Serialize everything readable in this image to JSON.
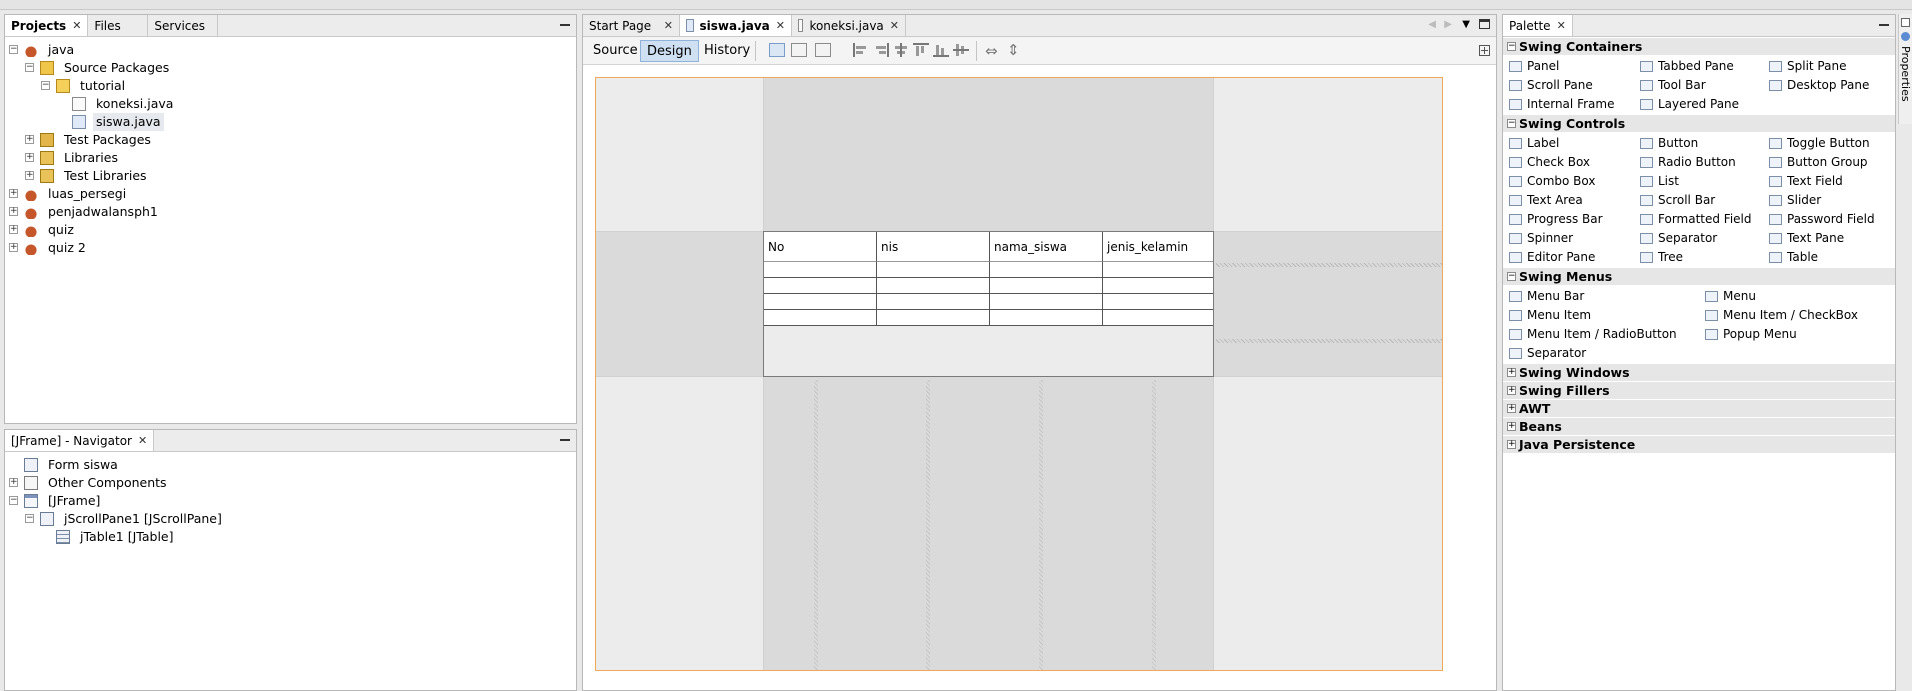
{
  "projects_panel": {
    "tabs": [
      "Projects",
      "Files",
      "Services"
    ],
    "tree": [
      {
        "label": "java",
        "level": 0,
        "expander": "−",
        "icon": "java-project-icon"
      },
      {
        "label": "Source Packages",
        "level": 1,
        "expander": "−",
        "icon": "source-packages-icon"
      },
      {
        "label": "tutorial",
        "level": 2,
        "expander": "−",
        "icon": "package-icon"
      },
      {
        "label": "koneksi.java",
        "level": 3,
        "expander": "",
        "icon": "java-file-icon"
      },
      {
        "label": "siswa.java",
        "level": 3,
        "expander": "",
        "icon": "form-file-icon"
      },
      {
        "label": "Test Packages",
        "level": 1,
        "expander": "+",
        "icon": "test-packages-icon"
      },
      {
        "label": "Libraries",
        "level": 1,
        "expander": "+",
        "icon": "libraries-icon"
      },
      {
        "label": "Test Libraries",
        "level": 1,
        "expander": "+",
        "icon": "test-libraries-icon"
      },
      {
        "label": "luas_persegi",
        "level": 0,
        "expander": "+",
        "icon": "java-project-icon"
      },
      {
        "label": "penjadwalansph1",
        "level": 0,
        "expander": "+",
        "icon": "java-project-icon"
      },
      {
        "label": "quiz",
        "level": 0,
        "expander": "+",
        "icon": "java-project-icon"
      },
      {
        "label": "quiz 2",
        "level": 0,
        "expander": "+",
        "icon": "java-project-icon"
      }
    ]
  },
  "navigator_panel": {
    "title": "[JFrame] - Navigator",
    "tree": [
      {
        "label": "Form siswa",
        "level": 0,
        "expander": "",
        "icon": "form-icon"
      },
      {
        "label": "Other Components",
        "level": 0,
        "expander": "+",
        "icon": "other-components-icon"
      },
      {
        "label": "[JFrame]",
        "level": 0,
        "expander": "−",
        "icon": "jframe-icon"
      },
      {
        "label": "jScrollPane1 [JScrollPane]",
        "level": 1,
        "expander": "−",
        "icon": "scrollpane-icon"
      },
      {
        "label": "jTable1 [JTable]",
        "level": 2,
        "expander": "",
        "icon": "table-icon"
      }
    ]
  },
  "editor": {
    "tabs": [
      "Start Page",
      "siswa.java",
      "koneksi.java"
    ],
    "active_tab": "siswa.java",
    "view_buttons": [
      "Source",
      "Design",
      "History"
    ],
    "active_view": "Design",
    "table_columns": [
      "No",
      "nis",
      "nama_siswa",
      "jenis_kelamin"
    ]
  },
  "palette": {
    "title": "Palette",
    "categories": [
      {
        "name": "Swing Containers",
        "expanded": true,
        "columns": 3,
        "items": [
          "Panel",
          "Tabbed Pane",
          "Split Pane",
          "Scroll Pane",
          "Tool Bar",
          "Desktop Pane",
          "Internal Frame",
          "Layered Pane"
        ]
      },
      {
        "name": "Swing Controls",
        "expanded": true,
        "columns": 3,
        "items": [
          "Label",
          "Button",
          "Toggle Button",
          "Check Box",
          "Radio Button",
          "Button Group",
          "Combo Box",
          "List",
          "Text Field",
          "Text Area",
          "Scroll Bar",
          "Slider",
          "Progress Bar",
          "Formatted Field",
          "Password Field",
          "Spinner",
          "Separator",
          "Text Pane",
          "Editor Pane",
          "Tree",
          "Table"
        ]
      },
      {
        "name": "Swing Menus",
        "expanded": true,
        "columns": 2,
        "items": [
          "Menu Bar",
          "Menu",
          "Menu Item",
          "Menu Item / CheckBox",
          "Menu Item / RadioButton",
          "Popup Menu",
          "Separator"
        ]
      },
      {
        "name": "Swing Windows",
        "expanded": false,
        "columns": 0,
        "items": []
      },
      {
        "name": "Swing Fillers",
        "expanded": false,
        "columns": 0,
        "items": []
      },
      {
        "name": "AWT",
        "expanded": false,
        "columns": 0,
        "items": []
      },
      {
        "name": "Beans",
        "expanded": false,
        "columns": 0,
        "items": []
      },
      {
        "name": "Java Persistence",
        "expanded": false,
        "columns": 0,
        "items": []
      }
    ]
  },
  "properties_side_tab": "Properties"
}
